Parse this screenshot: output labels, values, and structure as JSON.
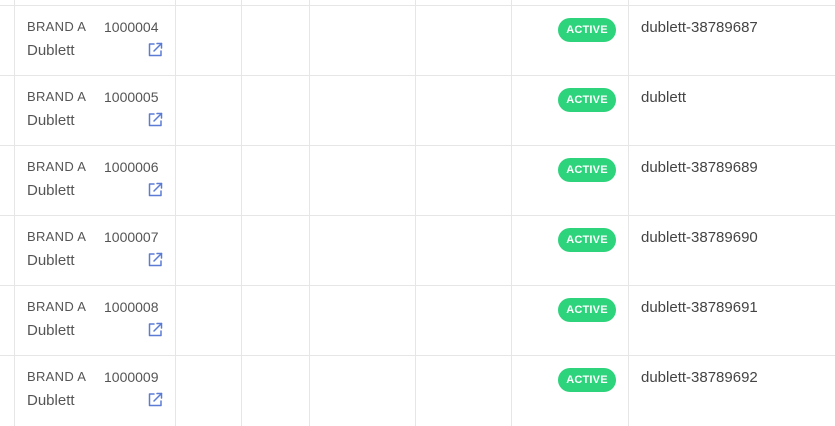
{
  "rows": [
    {
      "brand": "BRAND A",
      "name": "Dublett",
      "sku": "1000004",
      "status": "ACTIVE",
      "handle": "dublett-38789687"
    },
    {
      "brand": "BRAND A",
      "name": "Dublett",
      "sku": "1000005",
      "status": "ACTIVE",
      "handle": "dublett"
    },
    {
      "brand": "BRAND A",
      "name": "Dublett",
      "sku": "1000006",
      "status": "ACTIVE",
      "handle": "dublett-38789689"
    },
    {
      "brand": "BRAND A",
      "name": "Dublett",
      "sku": "1000007",
      "status": "ACTIVE",
      "handle": "dublett-38789690"
    },
    {
      "brand": "BRAND A",
      "name": "Dublett",
      "sku": "1000008",
      "status": "ACTIVE",
      "handle": "dublett-38789691"
    },
    {
      "brand": "BRAND A",
      "name": "Dublett",
      "sku": "1000009",
      "status": "ACTIVE",
      "handle": "dublett-38789692"
    }
  ],
  "colors": {
    "badge": "#2dd47c",
    "link_icon": "#5b7bd5",
    "grid": "#e6e6e6"
  },
  "icons": {
    "external_link": "external-link-icon"
  }
}
